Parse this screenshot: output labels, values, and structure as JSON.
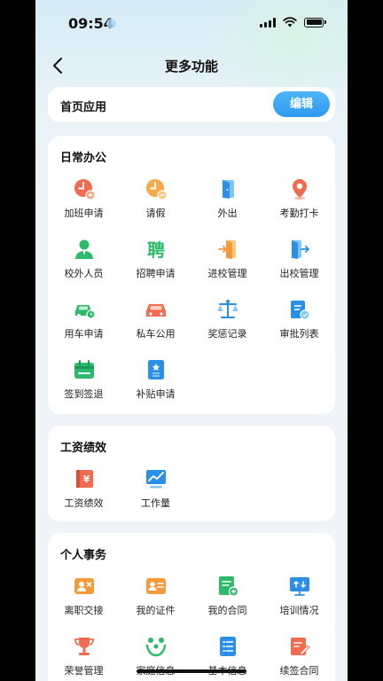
{
  "status_bar": {
    "time": "09:54"
  },
  "nav": {
    "title": "更多功能"
  },
  "home_apps": {
    "label": "首页应用",
    "edit_label": "编辑"
  },
  "sections": [
    {
      "title": "日常办公",
      "items": [
        {
          "label": "加班申请",
          "icon": "overtime-clock-icon"
        },
        {
          "label": "请假",
          "icon": "leave-clock-icon"
        },
        {
          "label": "外出",
          "icon": "door-exit-icon"
        },
        {
          "label": "考勤打卡",
          "icon": "location-pin-icon"
        },
        {
          "label": "校外人员",
          "icon": "person-icon"
        },
        {
          "label": "招聘申请",
          "icon": "recruit-icon"
        },
        {
          "label": "进校管理",
          "icon": "enter-door-icon"
        },
        {
          "label": "出校管理",
          "icon": "exit-door-icon"
        },
        {
          "label": "用车申请",
          "icon": "car-apply-icon"
        },
        {
          "label": "私车公用",
          "icon": "private-car-icon"
        },
        {
          "label": "奖惩记录",
          "icon": "scale-icon"
        },
        {
          "label": "审批列表",
          "icon": "approval-list-icon"
        },
        {
          "label": "签到签退",
          "icon": "calendar-sign-icon"
        },
        {
          "label": "补贴申请",
          "icon": "subsidy-doc-icon"
        }
      ]
    },
    {
      "title": "工资绩效",
      "items": [
        {
          "label": "工资绩效",
          "icon": "salary-book-icon"
        },
        {
          "label": "工作量",
          "icon": "workload-chart-icon"
        }
      ]
    },
    {
      "title": "个人事务",
      "items": [
        {
          "label": "离职交接",
          "icon": "resign-handover-icon"
        },
        {
          "label": "我的证件",
          "icon": "id-card-icon"
        },
        {
          "label": "我的合同",
          "icon": "contract-icon"
        },
        {
          "label": "培训情况",
          "icon": "training-board-icon"
        },
        {
          "label": "荣誉管理",
          "icon": "trophy-icon"
        },
        {
          "label": "家庭信息",
          "icon": "family-icon"
        },
        {
          "label": "基本信息",
          "icon": "basic-info-icon"
        },
        {
          "label": "续签合同",
          "icon": "renew-contract-icon"
        }
      ]
    }
  ]
}
